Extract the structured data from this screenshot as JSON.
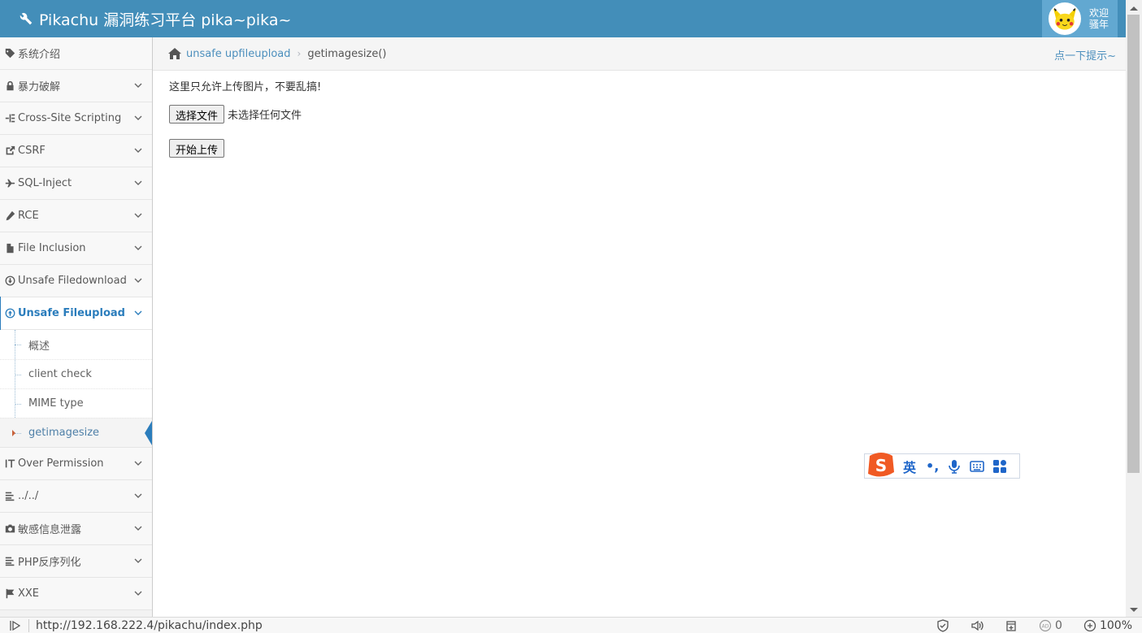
{
  "header": {
    "brand": "Pikachu 漏洞练习平台 pika~pika~",
    "user_line1": "欢迎",
    "user_line2": "骚年"
  },
  "sidebar": {
    "items": [
      {
        "label": "系统介绍",
        "icon": "tag-icon"
      },
      {
        "label": "暴力破解",
        "icon": "lock-icon"
      },
      {
        "label": "Cross-Site Scripting",
        "icon": "sitemap-icon"
      },
      {
        "label": "CSRF",
        "icon": "share-icon"
      },
      {
        "label": "SQL-Inject",
        "icon": "plane-icon"
      },
      {
        "label": "RCE",
        "icon": "pencil-icon"
      },
      {
        "label": "File Inclusion",
        "icon": "file-icon"
      },
      {
        "label": "Unsafe Filedownload",
        "icon": "download-circle-icon"
      },
      {
        "label": "Unsafe Fileupload",
        "icon": "upload-circle-icon"
      },
      {
        "label": "Over Permission",
        "icon": "text-height-icon"
      },
      {
        "label": "../../",
        "icon": "align-left-icon"
      },
      {
        "label": "敏感信息泄露",
        "icon": "camera-icon"
      },
      {
        "label": "PHP反序列化",
        "icon": "align-left-icon"
      },
      {
        "label": "XXE",
        "icon": "flag-icon"
      }
    ],
    "sub_items": [
      {
        "label": "概述"
      },
      {
        "label": "client check"
      },
      {
        "label": "MIME type"
      },
      {
        "label": "getimagesize"
      }
    ]
  },
  "breadcrumbs": {
    "link": "unsafe upfileupload",
    "current": "getimagesize()",
    "hint": "点一下提示~"
  },
  "content": {
    "notice": "这里只允许上传图片，不要乱搞!",
    "choose_file_label": "选择文件",
    "no_file_text": "未选择任何文件",
    "upload_label": "开始上传"
  },
  "ime": {
    "lang": "英",
    "punct": "•,"
  },
  "statusbar": {
    "url": "http://192.168.222.4/pikachu/index.php",
    "count": "0",
    "zoom": "100%"
  },
  "colors": {
    "navbar": "#438eb9",
    "user_box": "#62a8d1",
    "active_link": "#2b7dbc",
    "crumb_link": "#4c8fbd"
  }
}
